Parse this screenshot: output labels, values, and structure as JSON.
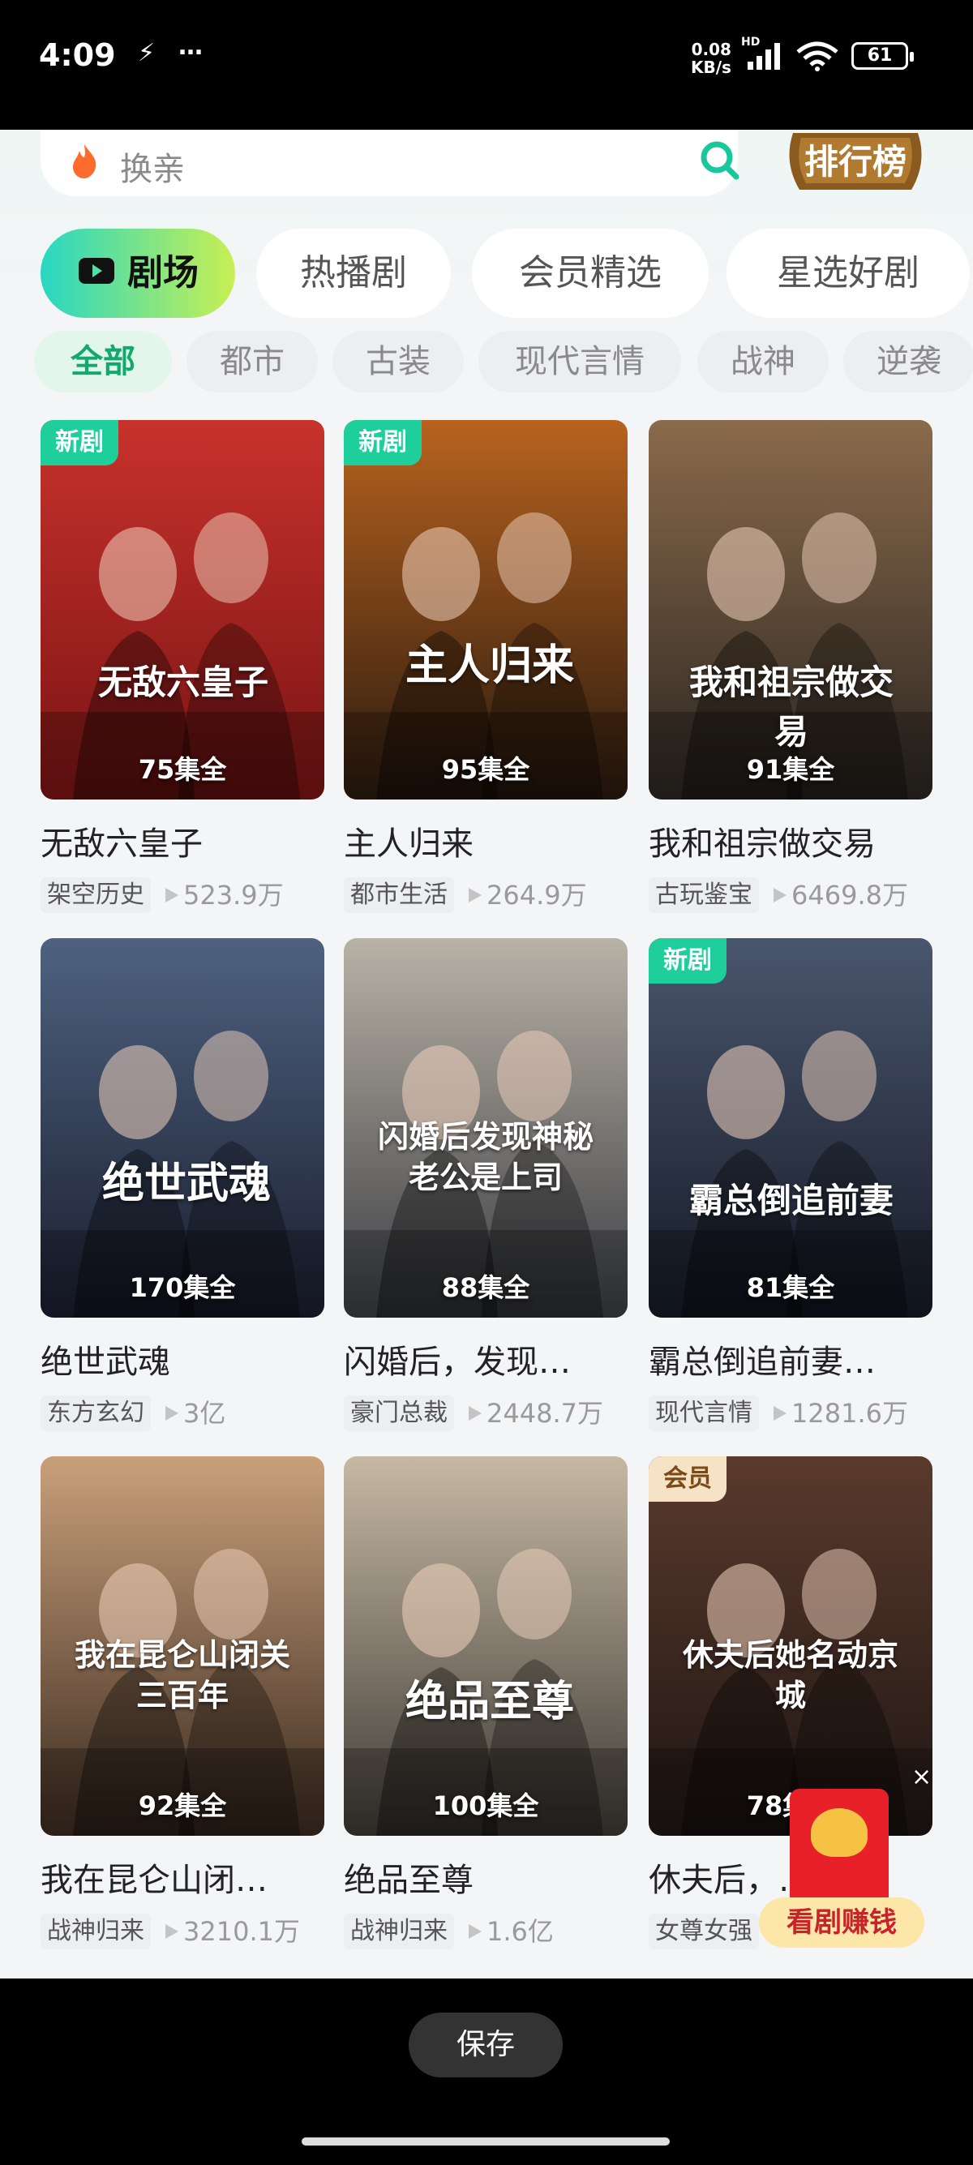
{
  "status_bar": {
    "time": "4:09",
    "glyphs": [
      "⚡",
      "…"
    ],
    "net_speed": "0.08",
    "net_unit": "KB/s",
    "net_type": "HD",
    "battery": "61"
  },
  "search": {
    "placeholder": "换亲",
    "rank_label": "排行榜"
  },
  "main_tabs": [
    "剧场",
    "热播剧",
    "会员精选",
    "星选好剧"
  ],
  "filter_chips": [
    "全部",
    "都市",
    "古装",
    "现代言情",
    "战神",
    "逆袭"
  ],
  "dramas": [
    {
      "title": "无敌六皇子",
      "poster_title": "无敌六皇子",
      "badge": "新剧",
      "episodes": "75集全",
      "genre": "架空历史",
      "views": "523.9万",
      "colors": [
        "#7a1414",
        "#c8322c"
      ]
    },
    {
      "title": "主人归来",
      "poster_title": "主人归来",
      "badge": "新剧",
      "episodes": "95集全",
      "genre": "都市生活",
      "views": "264.9万",
      "colors": [
        "#2a1a10",
        "#b8631e"
      ]
    },
    {
      "title": "我和祖宗做交易",
      "poster_title": "我和祖宗做交易",
      "badge": "",
      "episodes": "91集全",
      "genre": "古玩鉴宝",
      "views": "6469.8万",
      "colors": [
        "#2b2622",
        "#8a6a4a"
      ]
    },
    {
      "title": "绝世武魂",
      "poster_title": "绝世武魂",
      "badge": "",
      "episodes": "170集全",
      "genre": "东方玄幻",
      "views": "3亿",
      "colors": [
        "#1a1e2e",
        "#4e6280"
      ]
    },
    {
      "title": "闪婚后，发现…",
      "poster_title": "闪婚后发现神秘老公是上司",
      "badge": "",
      "episodes": "88集全",
      "genre": "豪门总裁",
      "views": "2448.7万",
      "colors": [
        "#3a3d42",
        "#b9b2a6"
      ]
    },
    {
      "title": "霸总倒追前妻…",
      "poster_title": "霸总倒追前妻",
      "badge": "新剧",
      "episodes": "81集全",
      "genre": "现代言情",
      "views": "1281.6万",
      "colors": [
        "#151a26",
        "#4a566e"
      ]
    },
    {
      "title": "我在昆仑山闭…",
      "poster_title": "我在昆仑山闭关三百年",
      "badge": "",
      "episodes": "92集全",
      "genre": "战神归来",
      "views": "3210.1万",
      "colors": [
        "#3a2a20",
        "#c9a07a"
      ]
    },
    {
      "title": "绝品至尊",
      "poster_title": "绝品至尊",
      "badge": "",
      "episodes": "100集全",
      "genre": "战神归来",
      "views": "1.6亿",
      "colors": [
        "#3e3a34",
        "#c6b9a4"
      ]
    },
    {
      "title": "休夫后，…",
      "poster_title": "休夫后她名动京城",
      "badge": "会员",
      "episodes": "78集全",
      "genre": "女尊女强",
      "views": "",
      "colors": [
        "#1e1614",
        "#5a3a2c"
      ]
    }
  ],
  "floating_promo": {
    "label": "看剧赚钱",
    "close": "×"
  },
  "bottom": {
    "save_label": "保存"
  },
  "colors": {
    "accent_green": "#12a96b",
    "badge_green": "#1fcf9b",
    "tab_gradient": [
      "#27d7c3",
      "#c9ef53"
    ]
  }
}
